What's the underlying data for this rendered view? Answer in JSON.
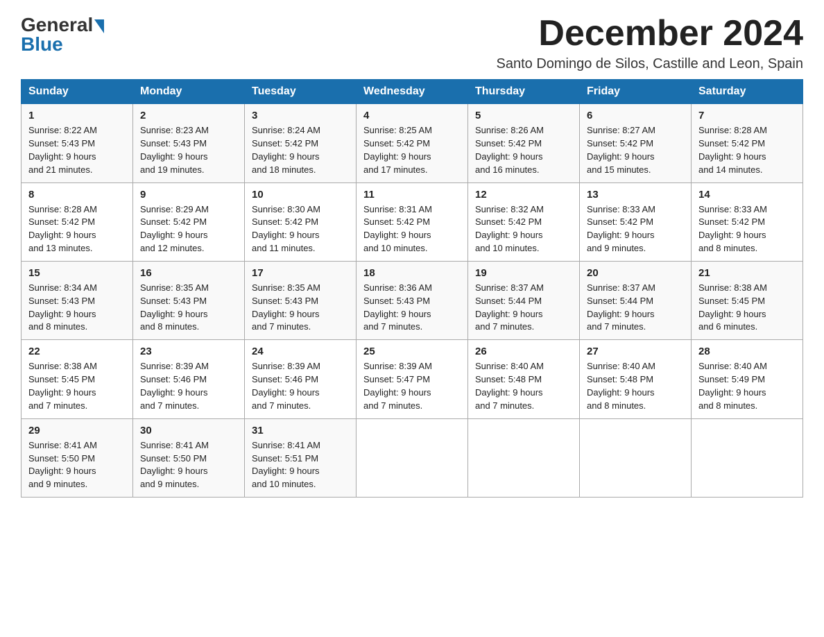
{
  "header": {
    "logo_general": "General",
    "logo_blue": "Blue",
    "month_title": "December 2024",
    "subtitle": "Santo Domingo de Silos, Castille and Leon, Spain"
  },
  "days_of_week": [
    "Sunday",
    "Monday",
    "Tuesday",
    "Wednesday",
    "Thursday",
    "Friday",
    "Saturday"
  ],
  "weeks": [
    [
      {
        "day": "1",
        "sunrise": "8:22 AM",
        "sunset": "5:43 PM",
        "daylight": "9 hours and 21 minutes."
      },
      {
        "day": "2",
        "sunrise": "8:23 AM",
        "sunset": "5:43 PM",
        "daylight": "9 hours and 19 minutes."
      },
      {
        "day": "3",
        "sunrise": "8:24 AM",
        "sunset": "5:42 PM",
        "daylight": "9 hours and 18 minutes."
      },
      {
        "day": "4",
        "sunrise": "8:25 AM",
        "sunset": "5:42 PM",
        "daylight": "9 hours and 17 minutes."
      },
      {
        "day": "5",
        "sunrise": "8:26 AM",
        "sunset": "5:42 PM",
        "daylight": "9 hours and 16 minutes."
      },
      {
        "day": "6",
        "sunrise": "8:27 AM",
        "sunset": "5:42 PM",
        "daylight": "9 hours and 15 minutes."
      },
      {
        "day": "7",
        "sunrise": "8:28 AM",
        "sunset": "5:42 PM",
        "daylight": "9 hours and 14 minutes."
      }
    ],
    [
      {
        "day": "8",
        "sunrise": "8:28 AM",
        "sunset": "5:42 PM",
        "daylight": "9 hours and 13 minutes."
      },
      {
        "day": "9",
        "sunrise": "8:29 AM",
        "sunset": "5:42 PM",
        "daylight": "9 hours and 12 minutes."
      },
      {
        "day": "10",
        "sunrise": "8:30 AM",
        "sunset": "5:42 PM",
        "daylight": "9 hours and 11 minutes."
      },
      {
        "day": "11",
        "sunrise": "8:31 AM",
        "sunset": "5:42 PM",
        "daylight": "9 hours and 10 minutes."
      },
      {
        "day": "12",
        "sunrise": "8:32 AM",
        "sunset": "5:42 PM",
        "daylight": "9 hours and 10 minutes."
      },
      {
        "day": "13",
        "sunrise": "8:33 AM",
        "sunset": "5:42 PM",
        "daylight": "9 hours and 9 minutes."
      },
      {
        "day": "14",
        "sunrise": "8:33 AM",
        "sunset": "5:42 PM",
        "daylight": "9 hours and 8 minutes."
      }
    ],
    [
      {
        "day": "15",
        "sunrise": "8:34 AM",
        "sunset": "5:43 PM",
        "daylight": "9 hours and 8 minutes."
      },
      {
        "day": "16",
        "sunrise": "8:35 AM",
        "sunset": "5:43 PM",
        "daylight": "9 hours and 8 minutes."
      },
      {
        "day": "17",
        "sunrise": "8:35 AM",
        "sunset": "5:43 PM",
        "daylight": "9 hours and 7 minutes."
      },
      {
        "day": "18",
        "sunrise": "8:36 AM",
        "sunset": "5:43 PM",
        "daylight": "9 hours and 7 minutes."
      },
      {
        "day": "19",
        "sunrise": "8:37 AM",
        "sunset": "5:44 PM",
        "daylight": "9 hours and 7 minutes."
      },
      {
        "day": "20",
        "sunrise": "8:37 AM",
        "sunset": "5:44 PM",
        "daylight": "9 hours and 7 minutes."
      },
      {
        "day": "21",
        "sunrise": "8:38 AM",
        "sunset": "5:45 PM",
        "daylight": "9 hours and 6 minutes."
      }
    ],
    [
      {
        "day": "22",
        "sunrise": "8:38 AM",
        "sunset": "5:45 PM",
        "daylight": "9 hours and 7 minutes."
      },
      {
        "day": "23",
        "sunrise": "8:39 AM",
        "sunset": "5:46 PM",
        "daylight": "9 hours and 7 minutes."
      },
      {
        "day": "24",
        "sunrise": "8:39 AM",
        "sunset": "5:46 PM",
        "daylight": "9 hours and 7 minutes."
      },
      {
        "day": "25",
        "sunrise": "8:39 AM",
        "sunset": "5:47 PM",
        "daylight": "9 hours and 7 minutes."
      },
      {
        "day": "26",
        "sunrise": "8:40 AM",
        "sunset": "5:48 PM",
        "daylight": "9 hours and 7 minutes."
      },
      {
        "day": "27",
        "sunrise": "8:40 AM",
        "sunset": "5:48 PM",
        "daylight": "9 hours and 8 minutes."
      },
      {
        "day": "28",
        "sunrise": "8:40 AM",
        "sunset": "5:49 PM",
        "daylight": "9 hours and 8 minutes."
      }
    ],
    [
      {
        "day": "29",
        "sunrise": "8:41 AM",
        "sunset": "5:50 PM",
        "daylight": "9 hours and 9 minutes."
      },
      {
        "day": "30",
        "sunrise": "8:41 AM",
        "sunset": "5:50 PM",
        "daylight": "9 hours and 9 minutes."
      },
      {
        "day": "31",
        "sunrise": "8:41 AM",
        "sunset": "5:51 PM",
        "daylight": "9 hours and 10 minutes."
      },
      null,
      null,
      null,
      null
    ]
  ],
  "sunrise_label": "Sunrise:",
  "sunset_label": "Sunset:",
  "daylight_label": "Daylight:"
}
